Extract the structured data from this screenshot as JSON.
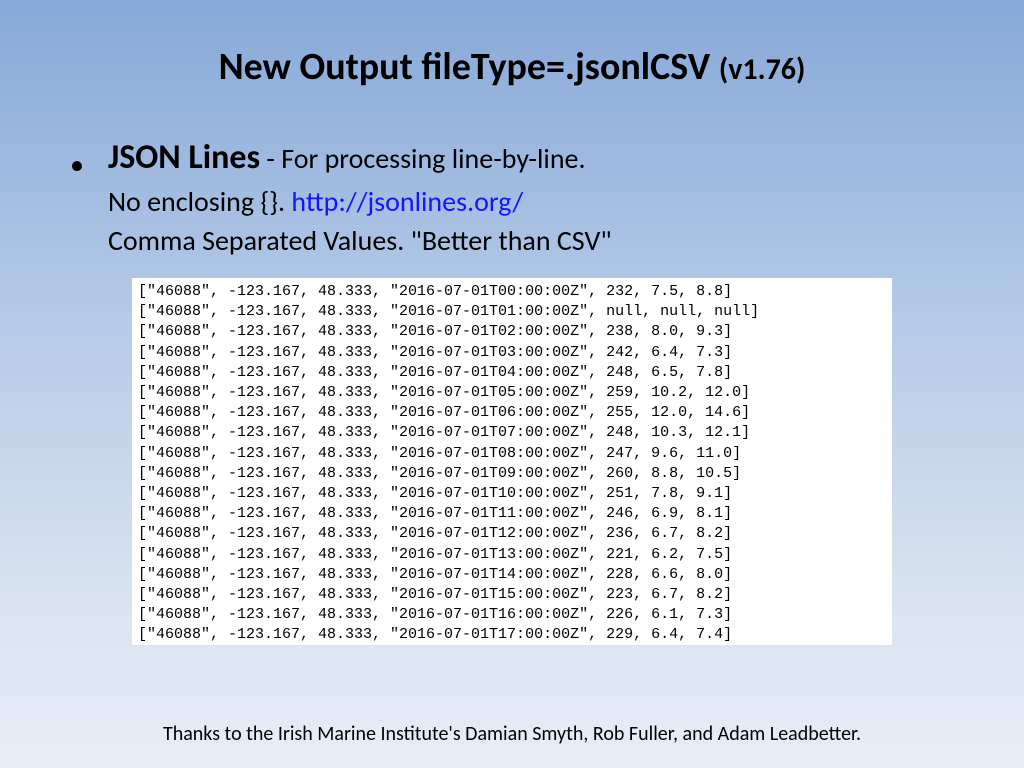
{
  "title_main": "New Output fileType=.jsonlCSV ",
  "title_ver": "(v1.76)",
  "lead": "JSON Lines",
  "desc_after_lead": " - For processing line-by-line.",
  "line2_a": "No enclosing  {}. ",
  "link": "http://jsonlines.org/",
  "line3": "Comma Separated Values. \"Better than CSV\"",
  "footer": "Thanks to the Irish Marine Institute's Damian Smyth, Rob Fuller, and Adam Leadbetter.",
  "rows": [
    {
      "id": "46088",
      "lon": -123.167,
      "lat": 48.333,
      "t": "2016-07-01T00:00:00Z",
      "a": "232",
      "b": "7.5",
      "c": "8.8"
    },
    {
      "id": "46088",
      "lon": -123.167,
      "lat": 48.333,
      "t": "2016-07-01T01:00:00Z",
      "a": "null",
      "b": "null",
      "c": "null"
    },
    {
      "id": "46088",
      "lon": -123.167,
      "lat": 48.333,
      "t": "2016-07-01T02:00:00Z",
      "a": "238",
      "b": "8.0",
      "c": "9.3"
    },
    {
      "id": "46088",
      "lon": -123.167,
      "lat": 48.333,
      "t": "2016-07-01T03:00:00Z",
      "a": "242",
      "b": "6.4",
      "c": "7.3"
    },
    {
      "id": "46088",
      "lon": -123.167,
      "lat": 48.333,
      "t": "2016-07-01T04:00:00Z",
      "a": "248",
      "b": "6.5",
      "c": "7.8"
    },
    {
      "id": "46088",
      "lon": -123.167,
      "lat": 48.333,
      "t": "2016-07-01T05:00:00Z",
      "a": "259",
      "b": "10.2",
      "c": "12.0"
    },
    {
      "id": "46088",
      "lon": -123.167,
      "lat": 48.333,
      "t": "2016-07-01T06:00:00Z",
      "a": "255",
      "b": "12.0",
      "c": "14.6"
    },
    {
      "id": "46088",
      "lon": -123.167,
      "lat": 48.333,
      "t": "2016-07-01T07:00:00Z",
      "a": "248",
      "b": "10.3",
      "c": "12.1"
    },
    {
      "id": "46088",
      "lon": -123.167,
      "lat": 48.333,
      "t": "2016-07-01T08:00:00Z",
      "a": "247",
      "b": "9.6",
      "c": "11.0"
    },
    {
      "id": "46088",
      "lon": -123.167,
      "lat": 48.333,
      "t": "2016-07-01T09:00:00Z",
      "a": "260",
      "b": "8.8",
      "c": "10.5"
    },
    {
      "id": "46088",
      "lon": -123.167,
      "lat": 48.333,
      "t": "2016-07-01T10:00:00Z",
      "a": "251",
      "b": "7.8",
      "c": "9.1"
    },
    {
      "id": "46088",
      "lon": -123.167,
      "lat": 48.333,
      "t": "2016-07-01T11:00:00Z",
      "a": "246",
      "b": "6.9",
      "c": "8.1"
    },
    {
      "id": "46088",
      "lon": -123.167,
      "lat": 48.333,
      "t": "2016-07-01T12:00:00Z",
      "a": "236",
      "b": "6.7",
      "c": "8.2"
    },
    {
      "id": "46088",
      "lon": -123.167,
      "lat": 48.333,
      "t": "2016-07-01T13:00:00Z",
      "a": "221",
      "b": "6.2",
      "c": "7.5"
    },
    {
      "id": "46088",
      "lon": -123.167,
      "lat": 48.333,
      "t": "2016-07-01T14:00:00Z",
      "a": "228",
      "b": "6.6",
      "c": "8.0"
    },
    {
      "id": "46088",
      "lon": -123.167,
      "lat": 48.333,
      "t": "2016-07-01T15:00:00Z",
      "a": "223",
      "b": "6.7",
      "c": "8.2"
    },
    {
      "id": "46088",
      "lon": -123.167,
      "lat": 48.333,
      "t": "2016-07-01T16:00:00Z",
      "a": "226",
      "b": "6.1",
      "c": "7.3"
    },
    {
      "id": "46088",
      "lon": -123.167,
      "lat": 48.333,
      "t": "2016-07-01T17:00:00Z",
      "a": "229",
      "b": "6.4",
      "c": "7.4"
    }
  ]
}
